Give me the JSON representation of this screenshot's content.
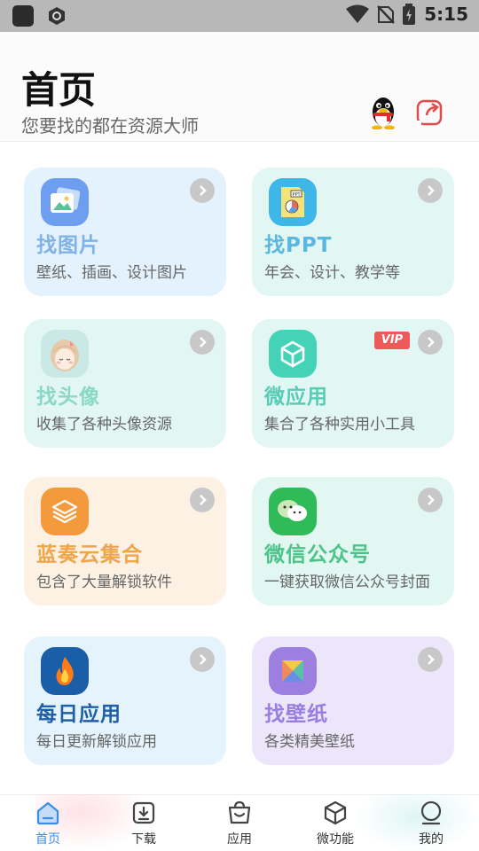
{
  "status_bar": {
    "time": "5:15",
    "icons": [
      "app-icon",
      "shield-app-icon",
      "wifi-icon",
      "no-sim-icon",
      "battery-charging-icon"
    ]
  },
  "header": {
    "title": "首页",
    "subtitle": "您要找的都在资源大师",
    "icons": [
      "qq-penguin-icon",
      "share-icon"
    ]
  },
  "cards": [
    {
      "title": "找图片",
      "desc": "壁纸、插画、设计图片",
      "icon": "image-gallery-icon",
      "title_color": "#7fb2e8",
      "bg": "#e4f2fd"
    },
    {
      "title": "找PPT",
      "desc": "年会、设计、教学等",
      "icon": "ppt-document-icon",
      "title_color": "#5ab8e0",
      "bg": "#e2f6f4"
    },
    {
      "title": "找头像",
      "desc": "收集了各种头像资源",
      "icon": "avatar-girl-icon",
      "title_color": "#8ad8c8",
      "bg": "#e2f6f3"
    },
    {
      "title": "微应用",
      "desc": "集合了各种实用小工具",
      "icon": "cube-icon",
      "title_color": "#58cbb4",
      "bg": "#e2f6f3",
      "badge": "VIP"
    },
    {
      "title": "蓝奏云集合",
      "desc": "包含了大量解锁软件",
      "icon": "layers-stack-icon",
      "title_color": "#f0a54a",
      "bg": "#fdf1e4"
    },
    {
      "title": "微信公众号",
      "desc": "一键获取微信公众号封面",
      "icon": "wechat-icon",
      "title_color": "#4cc489",
      "bg": "#e2f6f2"
    },
    {
      "title": "每日应用",
      "desc": "每日更新解锁应用",
      "icon": "flame-icon",
      "title_color": "#1e5fa8",
      "bg": "#e4f3fc"
    },
    {
      "title": "找壁纸",
      "desc": "各类精美壁纸",
      "icon": "tangram-wallpaper-icon",
      "title_color": "#9a7de0",
      "bg": "#ece6fa"
    }
  ],
  "bottom_nav": [
    {
      "label": "首页",
      "icon": "home-icon",
      "active": true
    },
    {
      "label": "下载",
      "icon": "download-icon",
      "active": false
    },
    {
      "label": "应用",
      "icon": "shopping-bag-icon",
      "active": false
    },
    {
      "label": "微功能",
      "icon": "cube-outline-icon",
      "active": false
    },
    {
      "label": "我的",
      "icon": "profile-icon",
      "active": false
    }
  ],
  "colors": {
    "accent_blue": "#3a8ee6",
    "chevron_gray": "#c8c8c8",
    "vip_red": "#ee5a5a"
  }
}
